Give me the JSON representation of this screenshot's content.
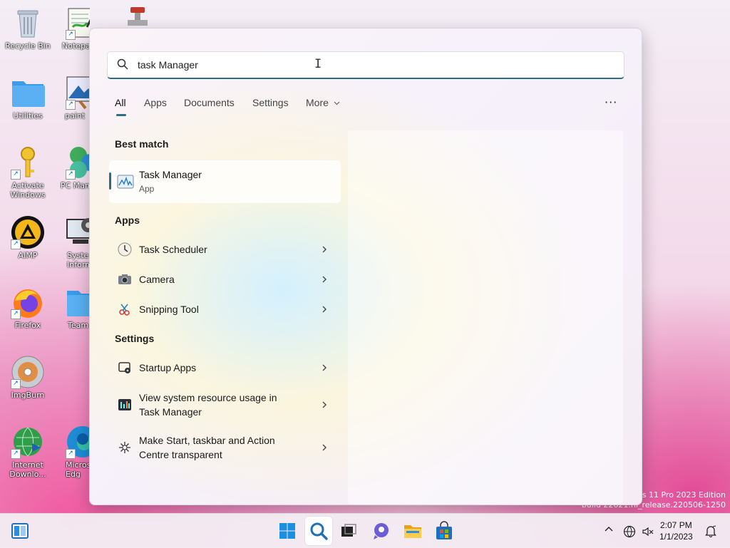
{
  "desktop": {
    "icons": [
      {
        "label": "Recycle Bin"
      },
      {
        "label": "Notepad"
      },
      {
        "label": "Utilities"
      },
      {
        "label": "paint"
      },
      {
        "label": "Activate Windows"
      },
      {
        "label": "PC Man"
      },
      {
        "label": "AIMP"
      },
      {
        "label": "Syste Inform"
      },
      {
        "label": "Firefox"
      },
      {
        "label": "Team"
      },
      {
        "label": "ImgBurn"
      },
      {
        "label": "Internet Downlo..."
      },
      {
        "label": "Micros Edg"
      }
    ],
    "watermark": {
      "line1": "ows 11 Pro 2023 Edition",
      "line2": "build 22621.ni_release.220506-1250"
    }
  },
  "search": {
    "query": "task Manager",
    "tabs": [
      {
        "label": "All"
      },
      {
        "label": "Apps"
      },
      {
        "label": "Documents"
      },
      {
        "label": "Settings"
      },
      {
        "label": "More"
      }
    ],
    "more_options": "···",
    "best_match": {
      "heading": "Best match",
      "name": "Task Manager",
      "type": "App"
    },
    "apps": {
      "heading": "Apps",
      "items": [
        {
          "label": "Task Scheduler"
        },
        {
          "label": "Camera"
        },
        {
          "label": "Snipping Tool"
        }
      ]
    },
    "settings": {
      "heading": "Settings",
      "items": [
        {
          "label": "Startup Apps"
        },
        {
          "line1": "View system resource usage in",
          "line2": "Task Manager"
        },
        {
          "line1": "Make Start, taskbar and Action",
          "line2": "Centre transparent"
        }
      ]
    }
  },
  "taskbar": {
    "clock": {
      "time": "2:07 PM",
      "date": "1/1/2023"
    }
  },
  "colors": {
    "accent": "#2b6f82",
    "taskbar_bg": "#f3ecf3"
  }
}
